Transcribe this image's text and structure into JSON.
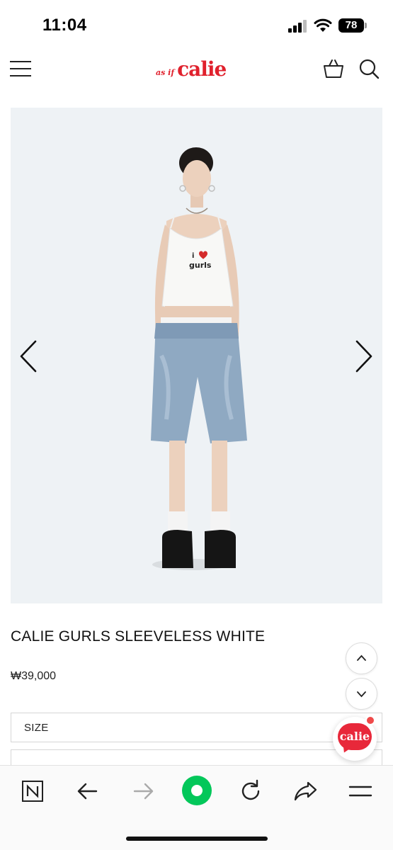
{
  "status_bar": {
    "time": "11:04",
    "battery": "78",
    "icons": [
      "cellular-signal-icon",
      "wifi-icon",
      "battery-icon"
    ]
  },
  "header": {
    "menu_icon": "hamburger-menu-icon",
    "logo_small": "as if",
    "logo_main": "calie",
    "cart_icon": "shopping-bag-icon",
    "search_icon": "search-icon",
    "brand_color": "#e0212d"
  },
  "gallery": {
    "image_icon": "model-photo",
    "prev_icon": "chevron-left-icon",
    "next_icon": "chevron-right-icon",
    "shirt_print_line1": "i",
    "shirt_print_line2": "gurls",
    "background_color": "#eef2f5"
  },
  "product": {
    "title": "CALIE GURLS SLEEVELESS WHITE",
    "price": "₩39,000"
  },
  "options": {
    "size_label": "SIZE"
  },
  "scroll_controls": {
    "up_icon": "chevron-up-icon",
    "down_icon": "chevron-down-icon"
  },
  "chat": {
    "label": "calie",
    "icon": "chat-bubble-icon",
    "color": "#e8283a"
  },
  "browser_toolbar": {
    "items": [
      {
        "icon": "naver-n-icon"
      },
      {
        "icon": "back-arrow-icon"
      },
      {
        "icon": "forward-arrow-icon"
      },
      {
        "icon": "green-home-icon"
      },
      {
        "icon": "reload-icon"
      },
      {
        "icon": "share-icon"
      },
      {
        "icon": "menu-icon"
      }
    ],
    "accent_color": "#03c75a"
  }
}
